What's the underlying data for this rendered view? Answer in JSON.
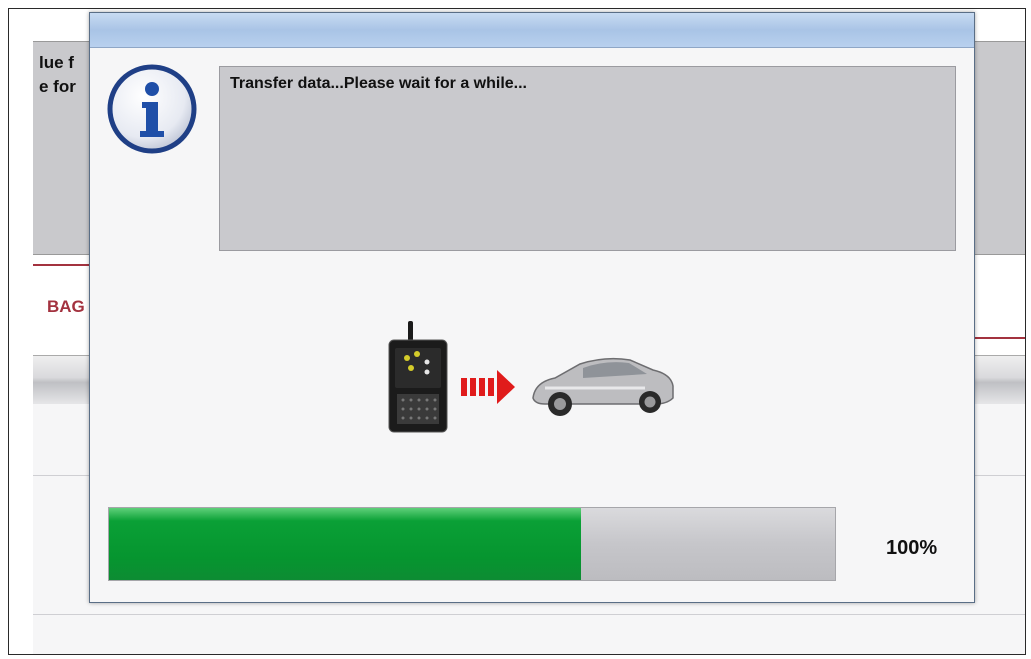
{
  "background": {
    "partial_line_1": "lue f",
    "partial_line_2": "e for",
    "partial_section": "BAG"
  },
  "dialog": {
    "message": "Transfer data...Please wait for a while...",
    "icon": "info-icon",
    "illustration": [
      "vci-device-icon",
      "arrow-right-icon",
      "car-icon"
    ],
    "progress": {
      "fraction": 0.65,
      "label": "100%"
    }
  },
  "colors": {
    "progress_green": "#06952f",
    "accent_red": "#a3323f",
    "info_blue": "#1f4fa8"
  }
}
